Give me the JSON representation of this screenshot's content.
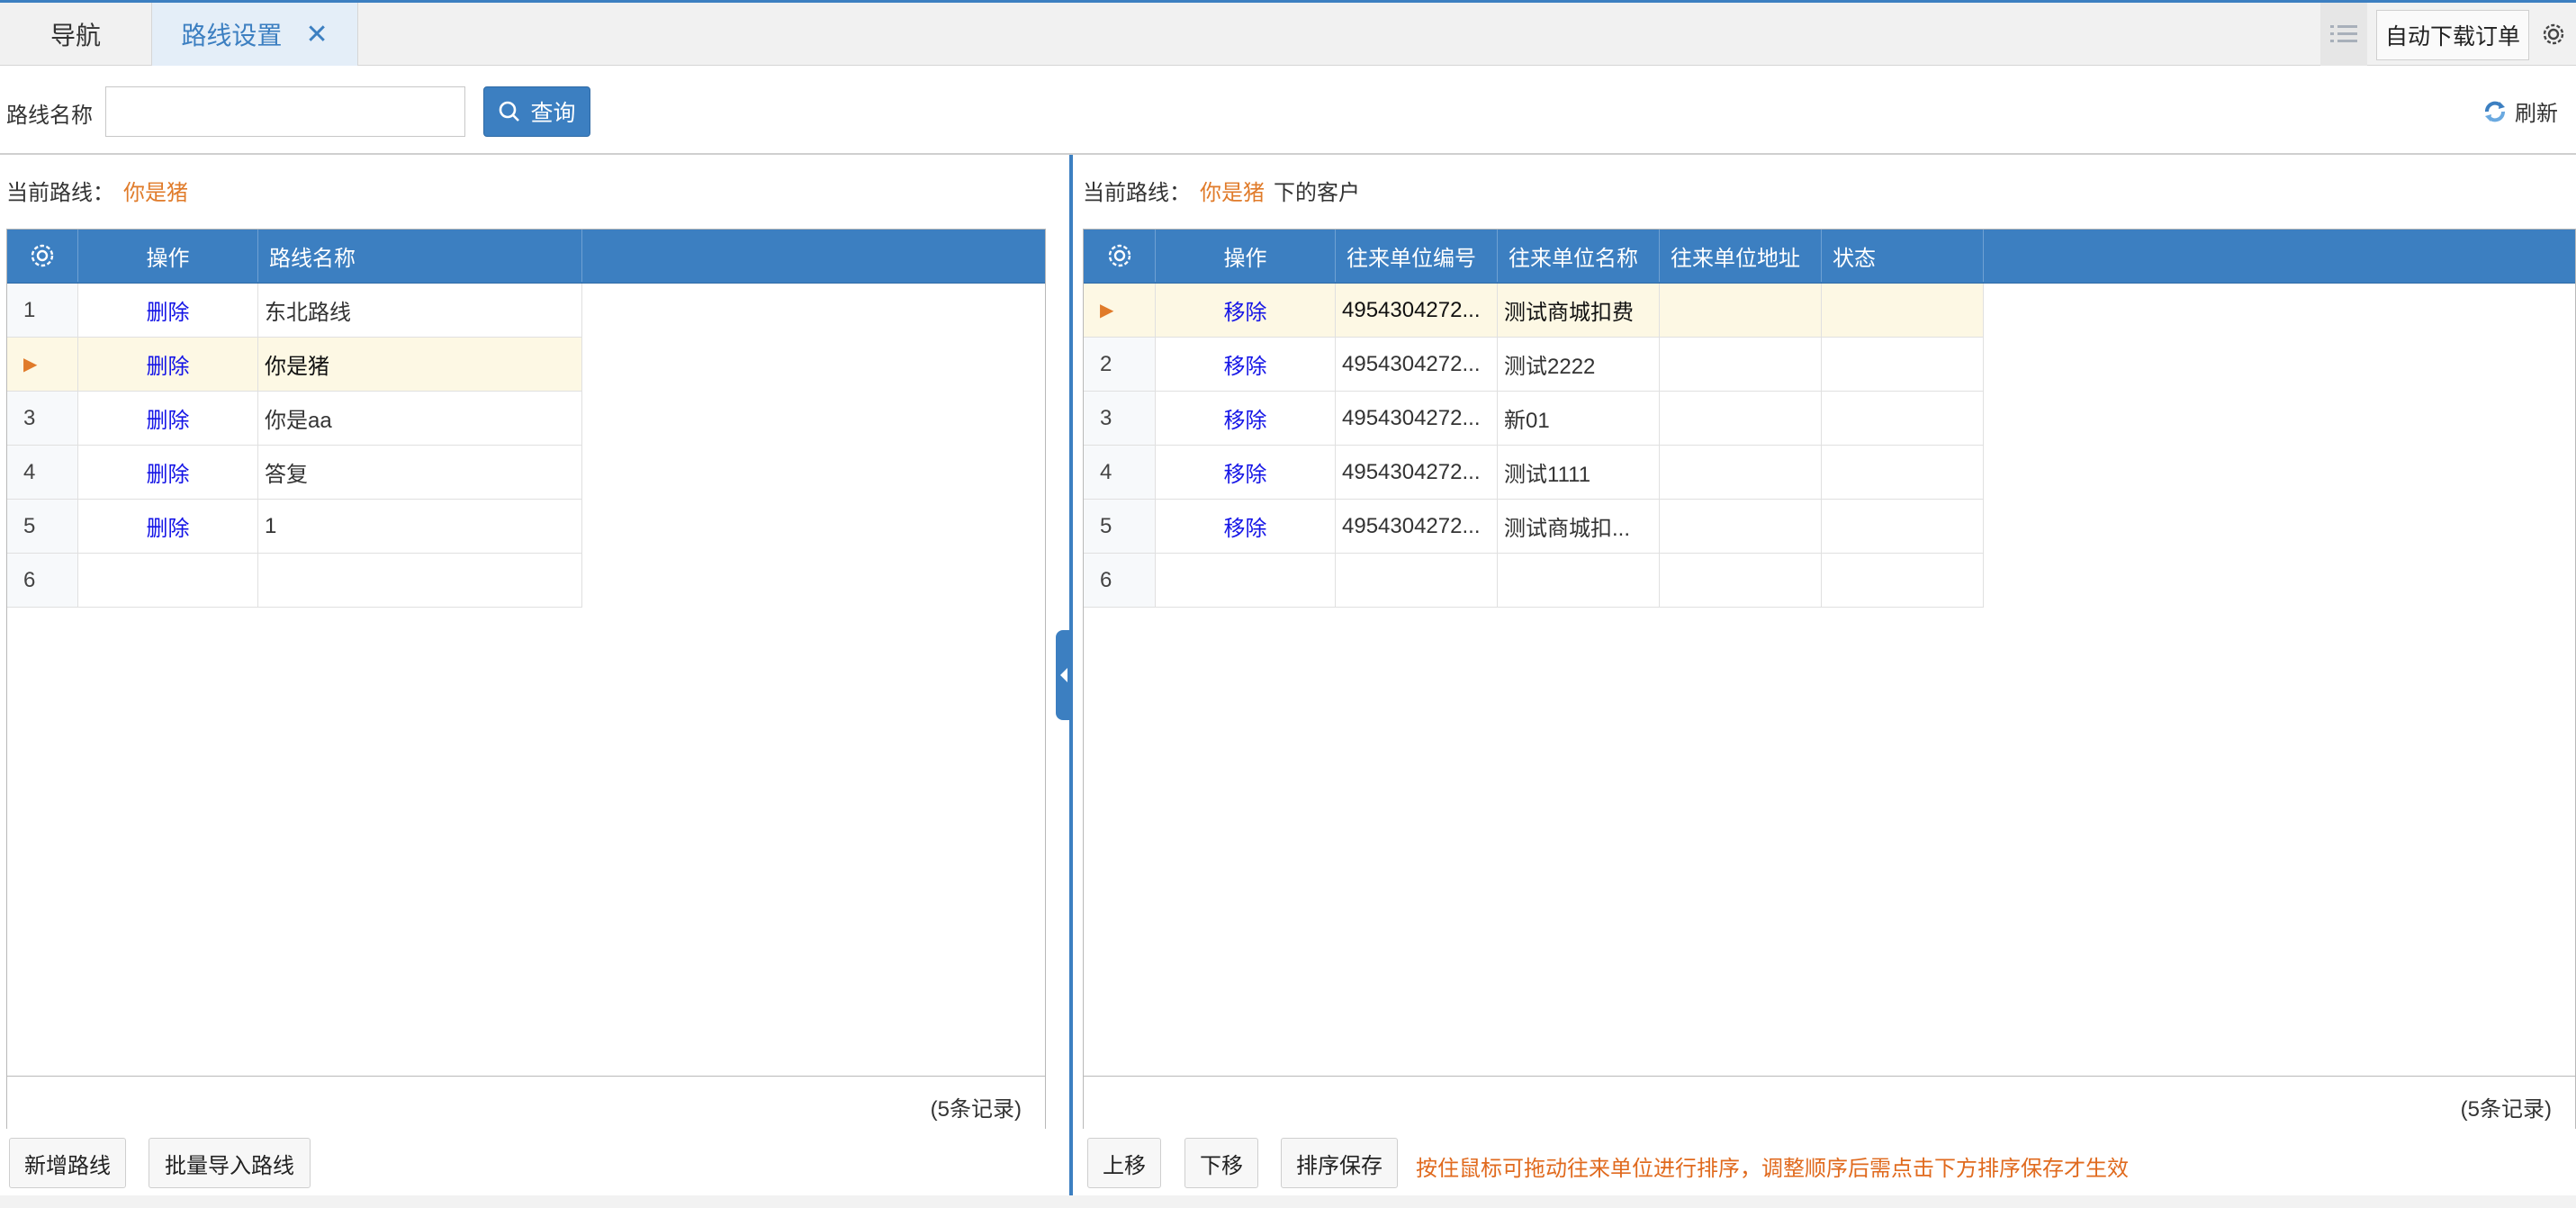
{
  "tabs": [
    {
      "label": "导航"
    },
    {
      "label": "路线设置"
    }
  ],
  "toolbar": {
    "auto_download_label": "自动下载订单"
  },
  "search": {
    "label": "路线名称",
    "value": "",
    "placeholder": "",
    "query_label": "查询",
    "refresh_label": "刷新"
  },
  "left": {
    "current_prefix": "当前路线：",
    "current_route": "你是猪",
    "columns": [
      "操作",
      "路线名称"
    ],
    "rows": [
      {
        "num": "1",
        "op": "删除",
        "name": "东北路线"
      },
      {
        "num": "",
        "op": "删除",
        "name": "你是猪"
      },
      {
        "num": "3",
        "op": "删除",
        "name": "你是aa"
      },
      {
        "num": "4",
        "op": "删除",
        "name": "答复"
      },
      {
        "num": "5",
        "op": "删除",
        "name": "1"
      },
      {
        "num": "6",
        "op": "",
        "name": ""
      }
    ],
    "record_count": "(5条记录)",
    "buttons": {
      "add": "新增路线",
      "import": "批量导入路线"
    }
  },
  "right": {
    "current_prefix": "当前路线：",
    "current_route": "你是猪",
    "current_suffix": "下的客户",
    "columns": [
      "操作",
      "往来单位编号",
      "往来单位名称",
      "往来单位地址",
      "状态"
    ],
    "rows": [
      {
        "num": "",
        "op": "移除",
        "code": "4954304272...",
        "name": "测试商城扣费",
        "addr": "",
        "status": ""
      },
      {
        "num": "2",
        "op": "移除",
        "code": "4954304272...",
        "name": "测试2222",
        "addr": "",
        "status": ""
      },
      {
        "num": "3",
        "op": "移除",
        "code": "4954304272...",
        "name": "新01",
        "addr": "",
        "status": ""
      },
      {
        "num": "4",
        "op": "移除",
        "code": "4954304272...",
        "name": "测试1111",
        "addr": "",
        "status": ""
      },
      {
        "num": "5",
        "op": "移除",
        "code": "4954304272...",
        "name": "测试商城扣...",
        "addr": "",
        "status": ""
      },
      {
        "num": "6",
        "op": "",
        "code": "",
        "name": "",
        "addr": "",
        "status": ""
      }
    ],
    "record_count": "(5条记录)",
    "buttons": {
      "up": "上移",
      "down": "下移",
      "save_order": "排序保存"
    },
    "hint": "按住鼠标可拖动往来单位进行排序，调整顺序后需点击下方排序保存才生效"
  },
  "colors": {
    "accent": "#3c7fc1",
    "highlight_text": "#e07b2a",
    "link": "#1515e6",
    "selected_row": "#fdf8e4"
  }
}
